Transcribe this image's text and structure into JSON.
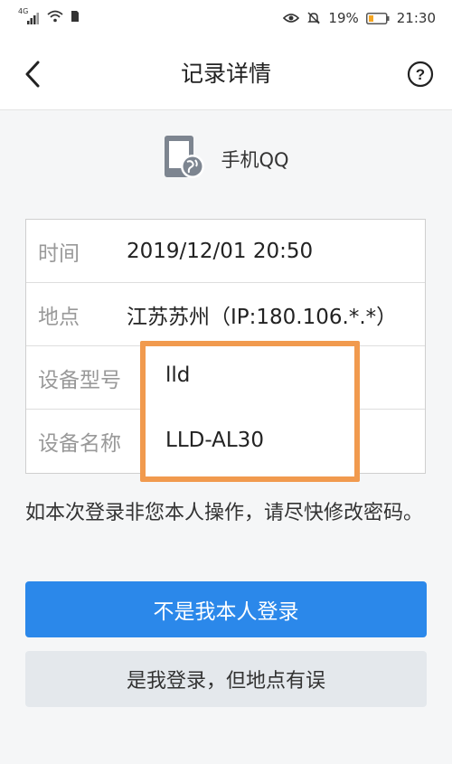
{
  "status_bar": {
    "network": "4G",
    "icons": [
      "signal-icon",
      "wifi-icon",
      "sim-icon",
      "eye-icon",
      "mute-icon"
    ],
    "battery_text": "19%",
    "time": "21:30"
  },
  "nav": {
    "back_icon": "chevron-left-icon",
    "title": "记录详情",
    "help_icon": "question-circle-icon",
    "help_glyph": "?"
  },
  "app": {
    "icon": "device-globe-icon",
    "name": "手机QQ"
  },
  "records": [
    {
      "label": "时间",
      "value": "2019/12/01 20:50"
    },
    {
      "label": "地点",
      "value": "江苏苏州（IP:180.106.*.*）"
    },
    {
      "label": "设备型号",
      "value": "lld"
    },
    {
      "label": "设备名称",
      "value": "LLD-AL30"
    }
  ],
  "notice": "如本次登录非您本人操作，请尽快修改密码。",
  "buttons": {
    "primary": "不是我本人登录",
    "secondary": "是我登录，但地点有误"
  },
  "colors": {
    "primary": "#2b88ea",
    "highlight_border": "#f19a4e",
    "secondary_bg": "#e4e8ec"
  }
}
